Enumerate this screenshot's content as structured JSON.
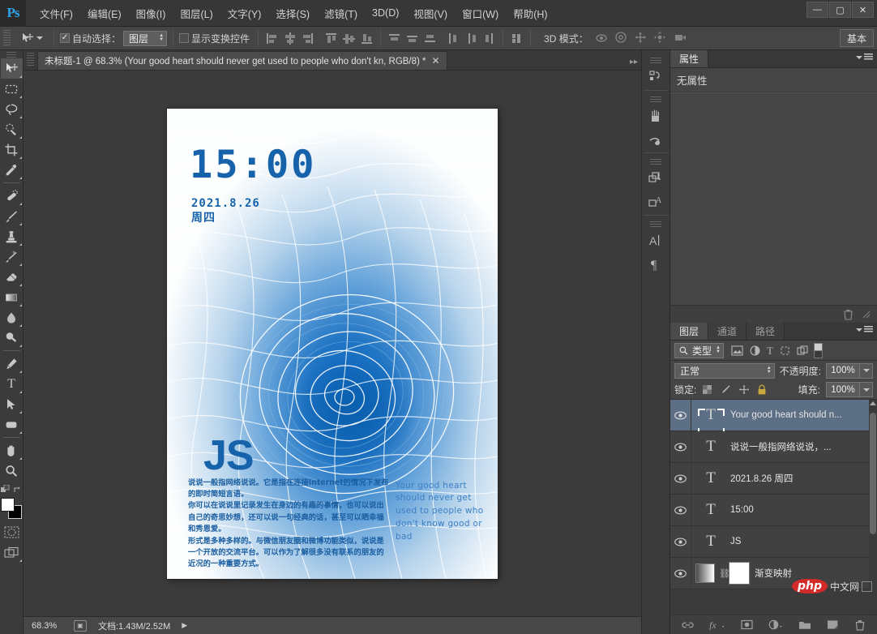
{
  "app": {
    "logo": "Ps",
    "menu": [
      "文件(F)",
      "编辑(E)",
      "图像(I)",
      "图层(L)",
      "文字(Y)",
      "选择(S)",
      "滤镜(T)",
      "3D(D)",
      "视图(V)",
      "窗口(W)",
      "帮助(H)"
    ],
    "window_controls": {
      "minimize": "—",
      "maximize": "▢",
      "close": "✕"
    }
  },
  "options_bar": {
    "tool_icon": "move-tool-icon",
    "auto_select_label": "自动选择：",
    "auto_select_checked": "✓",
    "auto_select_value": "图层",
    "show_transform_label": "显示变换控件",
    "mode3d_label": "3D 模式：",
    "workspace_button": "基本"
  },
  "toolbox": {
    "tools": [
      {
        "name": "move-tool",
        "active": true
      },
      {
        "name": "rectangular-marquee-tool",
        "active": false
      },
      {
        "name": "lasso-tool",
        "active": false
      },
      {
        "name": "quick-selection-tool",
        "active": false
      },
      {
        "name": "crop-tool",
        "active": false
      },
      {
        "name": "eyedropper-tool",
        "active": false
      },
      {
        "name": "healing-brush-tool",
        "active": false
      },
      {
        "name": "brush-tool",
        "active": false
      },
      {
        "name": "clone-stamp-tool",
        "active": false
      },
      {
        "name": "history-brush-tool",
        "active": false
      },
      {
        "name": "eraser-tool",
        "active": false
      },
      {
        "name": "gradient-tool",
        "active": false
      },
      {
        "name": "blur-tool",
        "active": false
      },
      {
        "name": "dodge-tool",
        "active": false
      },
      {
        "name": "pen-tool",
        "active": false
      },
      {
        "name": "type-tool",
        "active": false
      },
      {
        "name": "path-selection-tool",
        "active": false
      },
      {
        "name": "rectangle-tool",
        "active": false
      },
      {
        "name": "hand-tool",
        "active": false
      },
      {
        "name": "zoom-tool",
        "active": false
      }
    ],
    "foreground_color": "#ffffff",
    "background_color": "#000000"
  },
  "document": {
    "tab_title": "未标题-1 @ 68.3% (Your good heart  should never get  used to people  who don't kn, RGB/8) *",
    "tab_close": "✕",
    "canvas": {
      "time": "15:00",
      "date": "2021.8.26",
      "weekday": "周四",
      "js_logo": "JS",
      "paragraph_cn": "说说一般指网络说说。它是指在连接Internet的情况下发布的即时简短言语。\n你可以在说说里记录发生在身边的有趣的事情，也可以说出自己的奇思妙想，还可以说一句经典的话，甚至可以晒幸福和秀恩爱。\n形式是多种多样的。与微信朋友圈和微博功能类似，说说是一个开放的交流平台。可以作为了解很多没有联系的朋友的近况的一种重要方式。",
      "paragraph_en": "Your good heart should never get used to people who don't know good or bad",
      "accent_color": "#1763ab"
    }
  },
  "status_bar": {
    "zoom": "68.3%",
    "doc_info": "文档:1.43M/2.52M",
    "arrow": "▶"
  },
  "icon_rail": {
    "items": [
      "history-icon",
      "brush-presets-icon",
      "brush-settings-icon",
      "clone-source-icon",
      "adjustments-icon",
      "character-icon",
      "paragraph-icon"
    ]
  },
  "properties_panel": {
    "tab": "属性",
    "empty_text": "无属性"
  },
  "layers_panel": {
    "tabs": [
      {
        "label": "图层",
        "active": true
      },
      {
        "label": "通道",
        "active": false
      },
      {
        "label": "路径",
        "active": false
      }
    ],
    "filter": {
      "search_icon": "search-icon",
      "type_label": "类型",
      "kind_icons": [
        "pixel-filter-icon",
        "adjustment-filter-icon",
        "type-filter-icon",
        "shape-filter-icon",
        "smart-object-filter-icon"
      ]
    },
    "blend_mode": "正常",
    "opacity_label": "不透明度:",
    "opacity_value": "100%",
    "lock_label": "锁定:",
    "fill_label": "填充:",
    "fill_value": "100%",
    "layers": [
      {
        "name": "Your good heart  should n...",
        "type": "text",
        "selected": true,
        "visible": true
      },
      {
        "name": "说说一般指网络说说，...",
        "type": "text",
        "selected": false,
        "visible": true
      },
      {
        "name": "2021.8.26  周四",
        "type": "text",
        "selected": false,
        "visible": true
      },
      {
        "name": "15:00",
        "type": "text",
        "selected": false,
        "visible": true
      },
      {
        "name": "JS",
        "type": "text",
        "selected": false,
        "visible": true
      },
      {
        "name": "渐变映射",
        "type": "adjustment",
        "selected": false,
        "visible": true
      }
    ],
    "footer_icons": [
      "link-layers-icon",
      "layer-style-icon",
      "layer-mask-icon",
      "adjustment-layer-icon",
      "new-group-icon",
      "new-layer-icon",
      "delete-layer-icon"
    ]
  },
  "watermark": {
    "brand": "php",
    "suffix": "中文网"
  }
}
